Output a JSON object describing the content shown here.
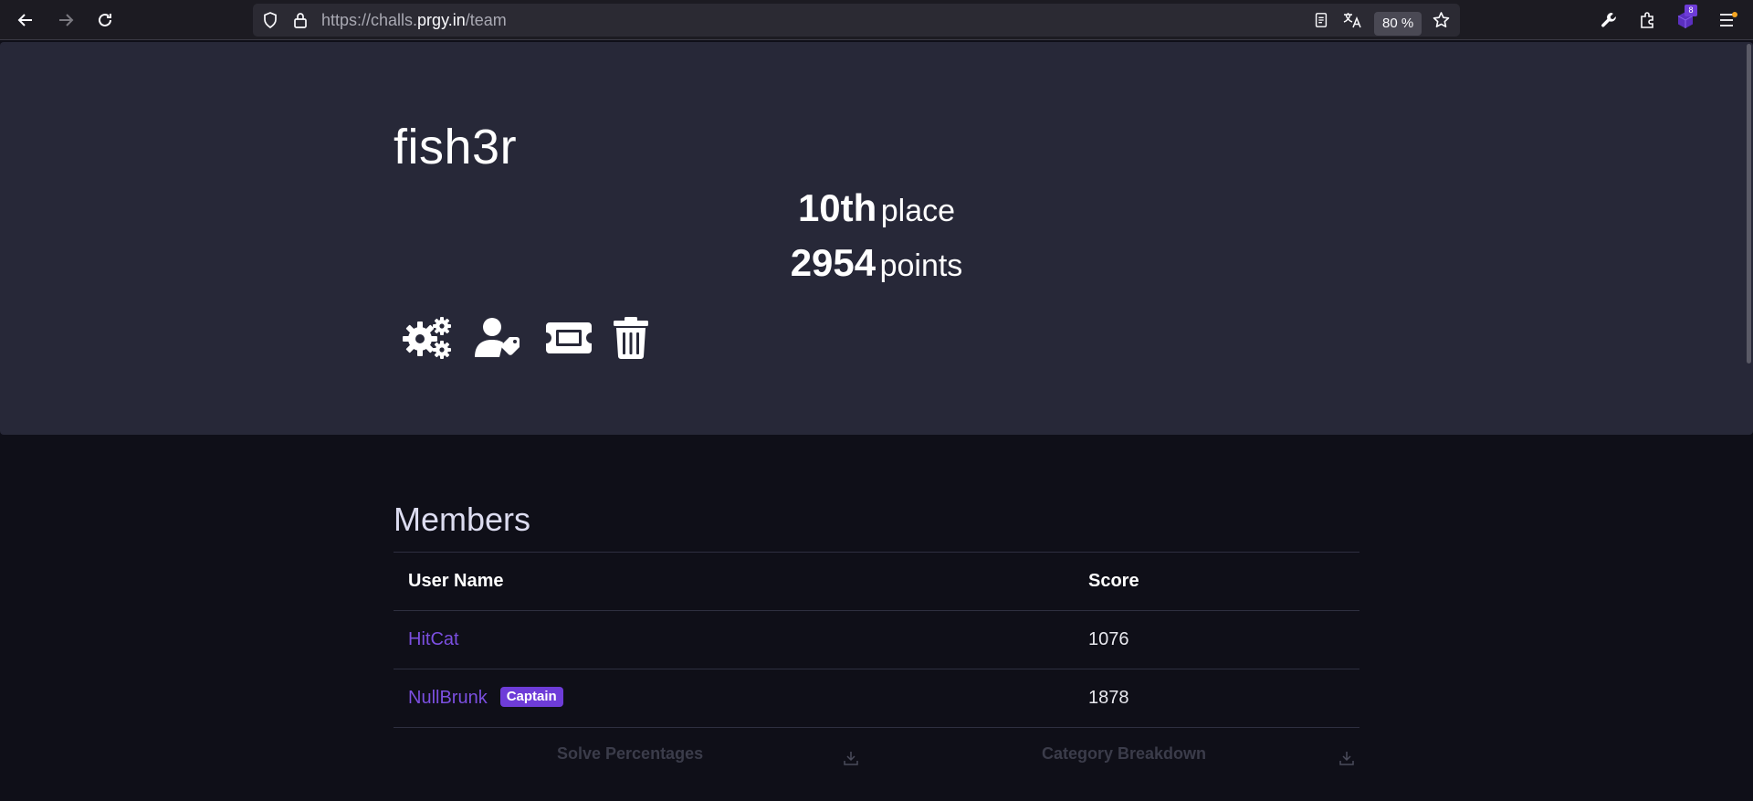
{
  "browser": {
    "url_prefix": "https://challs.",
    "url_host": "prgy.in",
    "url_path": "/team",
    "zoom": "80 %",
    "extension_badge": "8"
  },
  "team": {
    "name": "fish3r",
    "place_value": "10th",
    "place_label": "place",
    "points_value": "2954",
    "points_label": "points"
  },
  "actions": {
    "icons": [
      "gears-icon",
      "user-tag-icon",
      "ticket-icon",
      "trash-icon"
    ]
  },
  "members": {
    "title": "Members",
    "columns": [
      "User Name",
      "Score"
    ],
    "rows": [
      {
        "name": "HitCat",
        "score": "1076",
        "badge": ""
      },
      {
        "name": "NullBrunk",
        "score": "1878",
        "badge": "Captain"
      }
    ]
  },
  "charts": {
    "solve_title": "Solve Percentages",
    "category_title": "Category Breakdown"
  },
  "colors": {
    "accent": "#6e3cd8",
    "link": "#7b4fe0",
    "hero_bg": "#272838",
    "page_bg": "#0f0f18"
  }
}
